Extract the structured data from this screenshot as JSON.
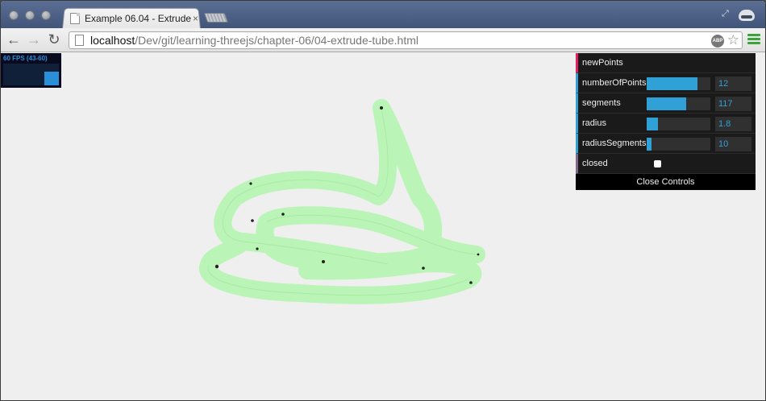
{
  "browser": {
    "tab_title": "Example 06.04 - Extrude",
    "tab_close": "×",
    "url_host": "localhost",
    "url_path": "/Dev/git/learning-threejs/chapter-06/04-extrude-tube.html",
    "icons": {
      "back": "back-arrow-icon",
      "forward": "forward-arrow-icon",
      "reload": "reload-icon",
      "page": "page-icon",
      "adblock": "adblock-icon",
      "star": "star-icon",
      "menu": "menu-icon",
      "incognito": "incognito-icon",
      "fullscreen": "fullscreen-icon"
    },
    "adblock_text": "ABP"
  },
  "stats": {
    "fps_text": "60 FPS (43-60)"
  },
  "controls": {
    "new_points_label": "newPoints",
    "number_of_points": {
      "label": "numberOfPoints",
      "value": "12",
      "fill": 0.8
    },
    "segments": {
      "label": "segments",
      "value": "117",
      "fill": 0.62
    },
    "radius": {
      "label": "radius",
      "value": "1.8",
      "fill": 0.18
    },
    "radius_segments": {
      "label": "radiusSegments",
      "value": "10",
      "fill": 0.08
    },
    "closed": {
      "label": "closed",
      "checked": false
    },
    "close_label": "Close Controls"
  },
  "colors": {
    "tube": "#b8f5b4",
    "gui_accent": "#2fa1d6",
    "stats_accent": "#2a8fd9"
  }
}
